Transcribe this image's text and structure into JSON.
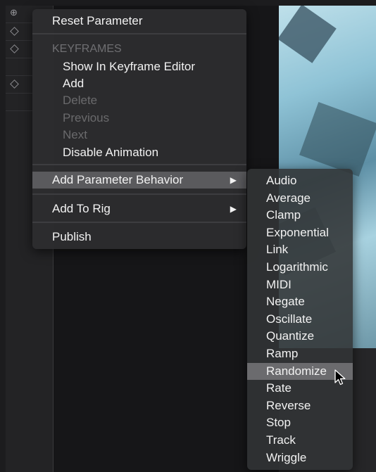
{
  "menu": {
    "reset": "Reset Parameter",
    "keyframes_header": "KEYFRAMES",
    "show_in_editor": "Show In Keyframe Editor",
    "add": "Add",
    "delete": "Delete",
    "previous": "Previous",
    "next": "Next",
    "disable_animation": "Disable Animation",
    "add_param_behavior": "Add Parameter Behavior",
    "add_to_rig": "Add To Rig",
    "publish": "Publish",
    "submenu_arrow": "▶"
  },
  "submenu": {
    "items": [
      "Audio",
      "Average",
      "Clamp",
      "Exponential",
      "Link",
      "Logarithmic",
      "MIDI",
      "Negate",
      "Oscillate",
      "Quantize",
      "Ramp",
      "Randomize",
      "Rate",
      "Reverse",
      "Stop",
      "Track",
      "Wriggle"
    ],
    "highlighted": "Randomize"
  },
  "icons": {
    "keyframe_button": "diamond-plus-icon",
    "cursor": "pointer-cursor-icon"
  },
  "colors": {
    "menu_bg": "#2c2c2e",
    "highlight": "#5a5a5d",
    "text": "#f2f2f2",
    "disabled_text": "#6a6a6c"
  }
}
